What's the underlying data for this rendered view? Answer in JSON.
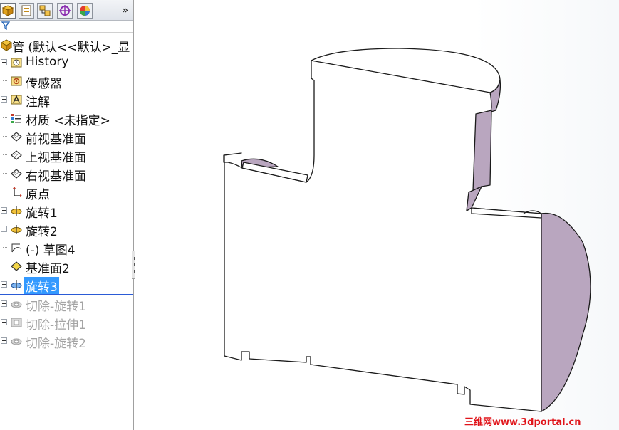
{
  "feature_tree": {
    "root_label": "管 (默认<<默认>_显",
    "items": [
      {
        "label": "History",
        "icon": "history-icon",
        "expandable": true
      },
      {
        "label": "传感器",
        "icon": "sensor-icon",
        "expandable": false
      },
      {
        "label": "注解",
        "icon": "annotation-icon",
        "expandable": true
      },
      {
        "label": "材质 <未指定>",
        "icon": "material-icon",
        "expandable": false
      },
      {
        "label": "前视基准面",
        "icon": "plane-icon",
        "expandable": false
      },
      {
        "label": "上视基准面",
        "icon": "plane-icon",
        "expandable": false
      },
      {
        "label": "右视基准面",
        "icon": "plane-icon",
        "expandable": false
      },
      {
        "label": "原点",
        "icon": "origin-icon",
        "expandable": false
      },
      {
        "label": "旋转1",
        "icon": "revolve-icon",
        "expandable": true
      },
      {
        "label": "旋转2",
        "icon": "revolve-icon",
        "expandable": true
      },
      {
        "label": "(-) 草图4",
        "icon": "sketch-icon",
        "expandable": false
      },
      {
        "label": "基准面2",
        "icon": "plane-icon",
        "expandable": false
      },
      {
        "label": "旋转3",
        "icon": "revolve-icon",
        "expandable": true,
        "selected": true
      },
      {
        "label": "切除-旋转1",
        "icon": "cut-revolve-icon",
        "expandable": true,
        "suppressed": true
      },
      {
        "label": "切除-拉伸1",
        "icon": "cut-extrude-icon",
        "expandable": true,
        "suppressed": true
      },
      {
        "label": "切除-旋转2",
        "icon": "cut-revolve-icon",
        "expandable": true,
        "suppressed": true
      }
    ]
  },
  "panel_tabs": [
    {
      "name": "featuremanager-tab",
      "icon": "feature-tree-icon",
      "active": true
    },
    {
      "name": "propertymanager-tab",
      "icon": "property-manager-icon",
      "active": false
    },
    {
      "name": "configurationmanager-tab",
      "icon": "configuration-icon",
      "active": false
    },
    {
      "name": "dimxpert-tab",
      "icon": "dimxpert-icon",
      "active": false
    },
    {
      "name": "display-manager-tab",
      "icon": "display-manager-icon",
      "active": false
    }
  ],
  "overflow_symbol": "»",
  "watermark": "三维网www.3dportal.cn",
  "colors": {
    "selection": "#3399ff",
    "rollback_bar": "#2b5bd6",
    "model_face": "#ffffff",
    "model_edge": "#1a1a1a",
    "cut_face": "#b9a6bf",
    "watermark": "#e0141a"
  }
}
